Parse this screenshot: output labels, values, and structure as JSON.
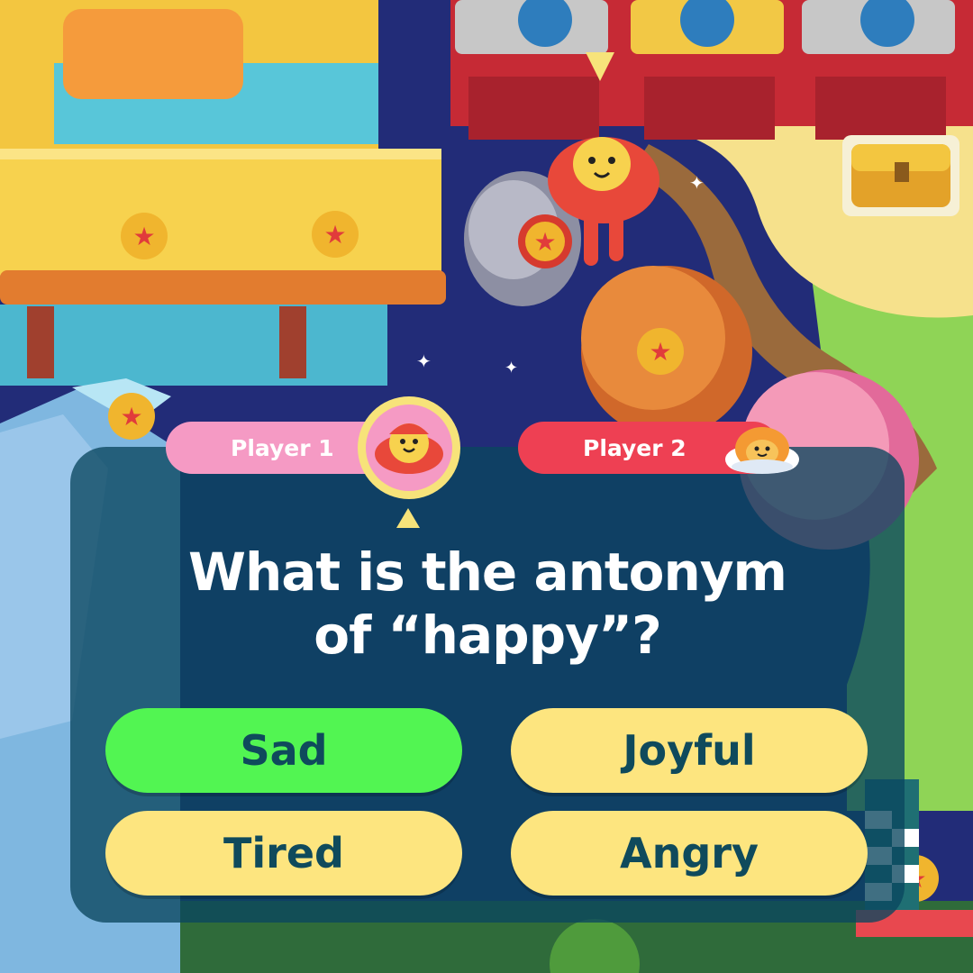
{
  "players": {
    "player1": {
      "label": "Player 1",
      "color": "#f59ac4"
    },
    "player2": {
      "label": "Player 2",
      "color": "#ee4053"
    }
  },
  "question": {
    "line1": "What is the antonym",
    "line2": "of “happy”?"
  },
  "answers": [
    {
      "label": "Sad",
      "state": "correct",
      "color": "#52f552"
    },
    {
      "label": "Joyful",
      "state": "default",
      "color": "#fde57f"
    },
    {
      "label": "Tired",
      "state": "default",
      "color": "#fde57f"
    },
    {
      "label": "Angry",
      "state": "default",
      "color": "#fde57f"
    }
  ],
  "icons": [
    "star-coin-icon",
    "treasure-chest-icon",
    "finish-flag-icon",
    "pointer-arrow-icon"
  ]
}
